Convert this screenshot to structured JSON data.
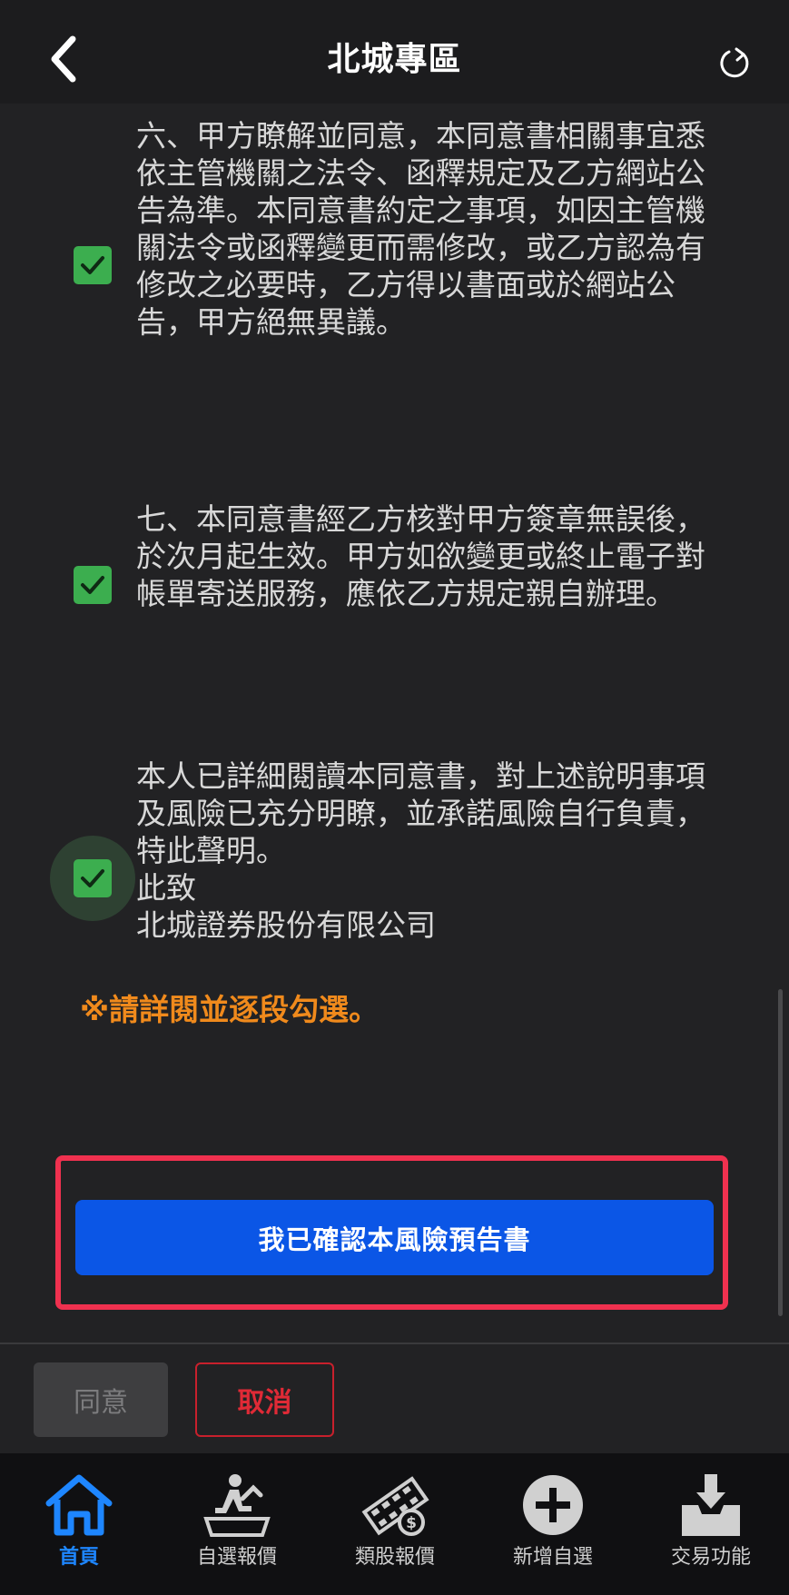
{
  "header": {
    "title": "北城專區",
    "back_icon": "chevron-left-icon",
    "refresh_icon": "refresh-icon"
  },
  "clauses": [
    {
      "text": "六、甲方瞭解並同意，本同意書相關事宜悉依主管機關之法令、函釋規定及乙方網站公告為準。本同意書約定之事項，如因主管機關法令或函釋變更而需修改，或乙方認為有修改之必要時，乙方得以書面或於網站公告，甲方絕無異議。",
      "checked": true
    },
    {
      "text": "七、本同意書經乙方核對甲方簽章無誤後，於次月起生效。甲方如欲變更或終止電子對帳單寄送服務，應依乙方規定親自辦理。",
      "checked": true
    },
    {
      "text": "本人已詳細閱讀本同意書，對上述說明事項及風險已充分明瞭，並承諾風險自行負責，特此聲明。\n此致\n北城證券股份有限公司",
      "checked": true
    }
  ],
  "notice": "※請詳閱並逐段勾選。",
  "confirm_button": "我已確認本風險預告書",
  "actions": {
    "agree": "同意",
    "cancel": "取消"
  },
  "bottom_nav": [
    {
      "label": "首頁",
      "icon": "home-icon",
      "active": true
    },
    {
      "label": "自選報價",
      "icon": "person-chart-icon",
      "active": false
    },
    {
      "label": "類股報價",
      "icon": "film-money-icon",
      "active": false
    },
    {
      "label": "新增自選",
      "icon": "plus-circle-icon",
      "active": false
    },
    {
      "label": "交易功能",
      "icon": "inbox-download-icon",
      "active": false
    }
  ],
  "colors": {
    "checkbox": "#3cae4f",
    "notice": "#f08a1c",
    "confirm": "#0b56e6",
    "highlight": "#f0314f",
    "cancel": "#e02a36",
    "nav_active": "#1e86ff"
  }
}
